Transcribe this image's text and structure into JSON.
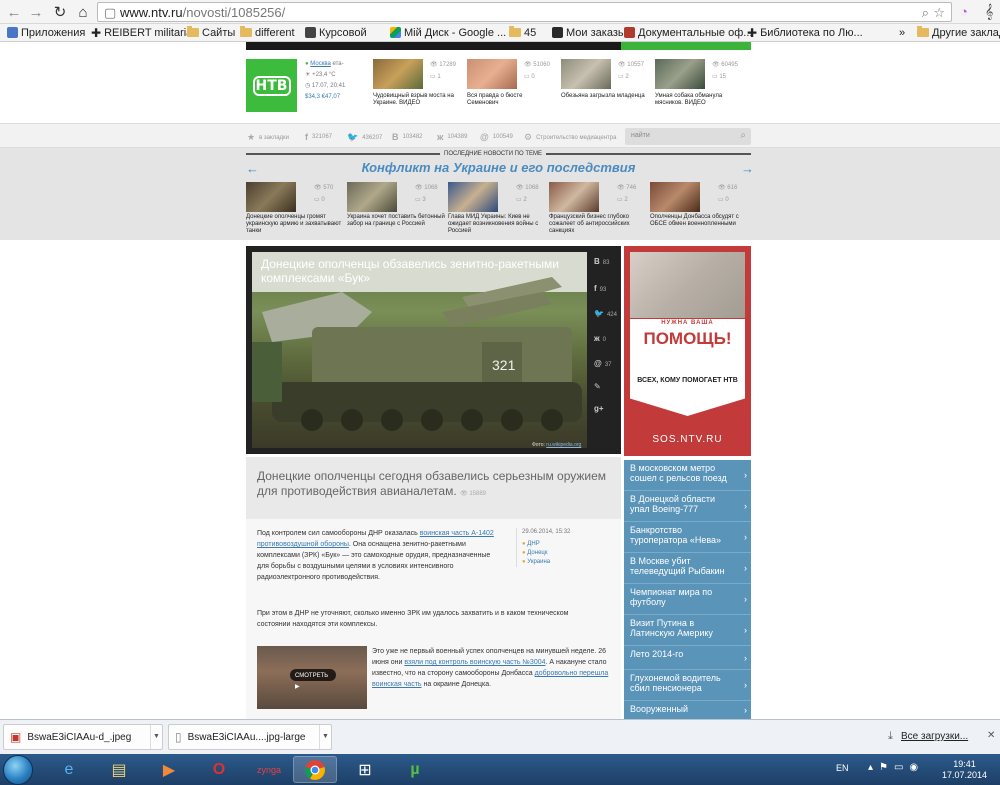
{
  "browser": {
    "url_prefix": "www.ntv.ru",
    "url_path": "/novosti/1085256/"
  },
  "bookmarks": [
    {
      "label": "Приложения",
      "icon": "apps-grid-icon"
    },
    {
      "label": "REIBERT militaria",
      "icon": "cross-icon"
    },
    {
      "label": "Сайты",
      "icon": "folder-icon"
    },
    {
      "label": "different",
      "icon": "folder-icon"
    },
    {
      "label": "Курсовой",
      "icon": "doc-icon"
    },
    {
      "label": "Мій Диск - Google ...",
      "icon": "drive-icon"
    },
    {
      "label": "45",
      "icon": "folder-icon"
    },
    {
      "label": "Мои заказы",
      "icon": "cart-icon"
    },
    {
      "label": "Документальные оф...",
      "icon": "doc-icon"
    },
    {
      "label": "Библиотека по Лю...",
      "icon": "cross-icon"
    },
    {
      "label": "Другие закладки",
      "icon": "folder-icon"
    }
  ],
  "header": {
    "logo_text": "НТВ",
    "weather": {
      "city": "Москва",
      "city_suffix": "ета-",
      "temp": "+23,4 °С",
      "date": "17.07, 20:41",
      "usd": "$34,3",
      "eur": "€47,07"
    },
    "top_news": [
      {
        "caption": "Чудовищный взрыв моста на Украине. ВИДЕО",
        "views": "17289",
        "comments": "1"
      },
      {
        "caption": "Вся правда о бюсте Семенович",
        "views": "51060",
        "comments": "0"
      },
      {
        "caption": "Обезьяна загрызла младенца",
        "views": "10557",
        "comments": "2"
      },
      {
        "caption": "Умная собака обманула мясников. ВИДЕО",
        "views": "60495",
        "comments": "15"
      }
    ]
  },
  "social": {
    "bookmark": "в закладки",
    "fb": "321067",
    "tw": "436207",
    "vk": "103482",
    "ok": "104389",
    "mail": "100549",
    "media": "Строительство медиацентра",
    "search_placeholder": "найти"
  },
  "conflict": {
    "kicker": "ПОСЛЕДНИЕ НОВОСТИ ПО ТЕМЕ",
    "title": "Конфликт на Украине и его последствия",
    "items": [
      {
        "caption": "Донецкие ополченцы громят украинскую армию и захватывают танки",
        "views": "570",
        "comments": "0"
      },
      {
        "caption": "Украина хочет поставить бетонный забор на границе с Россией",
        "views": "1068",
        "comments": "3"
      },
      {
        "caption": "Глава МИД Украины: Киев не ожидает возникновения войны с Россией",
        "views": "1068",
        "comments": "2"
      },
      {
        "caption": "Французский бизнес глубоко сожалеет об антироссийских санкциях",
        "views": "746",
        "comments": "2"
      },
      {
        "caption": "Ополченцы Донбасса обсудят с ОБСЕ обмен военнопленными",
        "views": "616",
        "comments": "0"
      }
    ]
  },
  "article": {
    "hero_title": "Донецкие ополченцы обзавелись зенитно-ракетными комплексами «Бук»",
    "hero_side": [
      "83",
      "93",
      "424",
      "0",
      "37",
      "",
      ""
    ],
    "photo_credit_label": "Фото:",
    "photo_credit_link": "ru.wikipedia.org",
    "lead": "Донецкие ополченцы сегодня обзавелись серьезным оружием для противодействия авианалетам.",
    "lead_views": "15889",
    "p1_before": "Под контролем сил самообороны ДНР оказалась ",
    "p1_link": "воинская часть А-1402 противовоздушной обороны",
    "p1_after": ". Она оснащена зенитно-ракетными комплексами (ЗРК) «Бук» — это самоходные орудия, предназначенные для борьбы с воздушными целями в условиях интенсивного радиоэлектронного противодействия.",
    "p2": "При этом в ДНР не уточняют, сколько именно ЗРК им удалось захватить и в каком техническом состоянии находятся эти комплексы.",
    "p3_a": "Это уже не первый военный успех ополченцев на минувшей неделе. 26 июня они ",
    "p3_link1": "взяли под контроль воинскую часть №3004",
    "p3_b": ". А накануне стало известно, что на сторону самообороны Донбасса ",
    "p3_link2": "добровольно перешла воинская часть",
    "p3_c": " на окраине Донецка.",
    "date": "29.06.2014, 15:32",
    "tags": [
      "ДНР",
      "Донецк",
      "Украина"
    ],
    "video_label": "СМОТРЕТЬ"
  },
  "ad": {
    "small": "НУЖНА ВАША",
    "big": "ПОМОЩЬ!",
    "who": "ВСЕХ, КОМУ ПОМОГАЕТ НТВ",
    "url": "SOS.NTV.RU"
  },
  "right_list": [
    "В московском метро сошел с рельсов поезд",
    "В Донецкой области упал Boeing-777",
    "Банкротство туроператора «Нева»",
    "В Москве убит телеведущий Рыбакин",
    "Чемпионат мира по футболу",
    "Визит Путина в Латинскую Америку",
    "Лето 2014-го",
    "Глухонемой водитель сбил пенсионера",
    "Вооруженный"
  ],
  "downloads": [
    {
      "name": "BswaE3iCIAAu-d_.jpeg",
      "type": "pdf-file-icon"
    },
    {
      "name": "BswaE3iCIAAu....jpg-large",
      "type": "generic-file-icon"
    }
  ],
  "downloads_all": "Все загрузки...",
  "taskbar": {
    "lang": "EN",
    "time": "19:41",
    "date": "17.07.2014"
  },
  "colors": {
    "ntv_green": "#3cbb3c",
    "link_blue": "#3a7ab5",
    "conflict_blue": "#4a8bc0",
    "ad_red": "#c23a3a",
    "list_blue": "#5a94b8"
  }
}
